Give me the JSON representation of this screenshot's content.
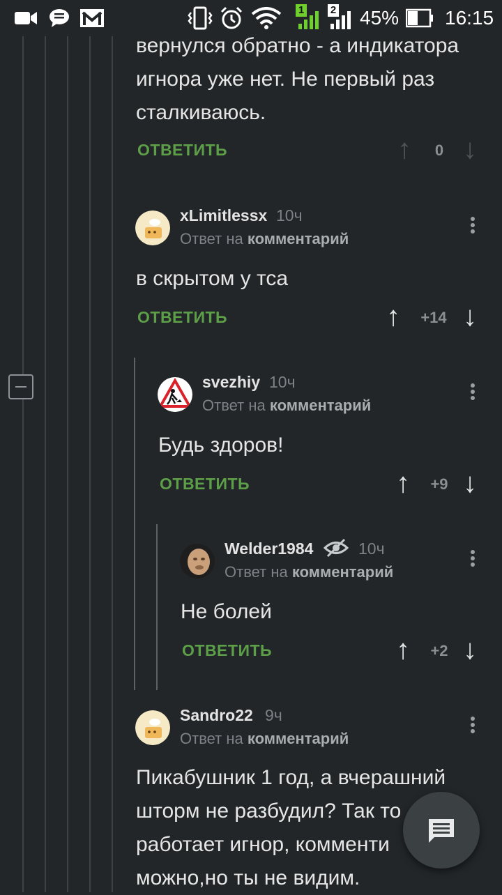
{
  "status_bar": {
    "battery": "45%",
    "time": "16:15",
    "sim1": "1",
    "sim2": "2"
  },
  "colors": {
    "background": "#222628",
    "reply_green": "#5d9f48",
    "text": "#e6e6e6",
    "muted": "#7c8285"
  },
  "top_comment": {
    "lines": [
      "вернулся обратно - а индикатора",
      "игнора уже нет. Не первый раз",
      "сталкиваюсь."
    ],
    "reply_label": "ОТВЕТИТЬ",
    "score": "0"
  },
  "comments": [
    {
      "author": "xLimitlessx",
      "time": "10ч",
      "reply_prefix": "Ответ на",
      "reply_link": "комментарий",
      "text": "в скрытом у тса",
      "reply_label": "ОТВЕТИТЬ",
      "score": "+14"
    },
    {
      "author": "svezhiy",
      "time": "10ч",
      "reply_prefix": "Ответ на",
      "reply_link": "комментарий",
      "text": "Будь здоров!",
      "reply_label": "ОТВЕТИТЬ",
      "score": "+9"
    },
    {
      "author": "Welder1984",
      "time": "10ч",
      "reply_prefix": "Ответ на",
      "reply_link": "комментарий",
      "text": "Не болей",
      "reply_label": "ОТВЕТИТЬ",
      "score": "+2"
    },
    {
      "author": "Sandro22",
      "time": "9ч",
      "reply_prefix": "Ответ на",
      "reply_link": "комментарий",
      "lines": [
        "Пикабушник 1 год, а вчерашний",
        "шторм не разбудил? Так то",
        "работает игнор, комменти",
        "можно,но ты не видим."
      ]
    }
  ]
}
